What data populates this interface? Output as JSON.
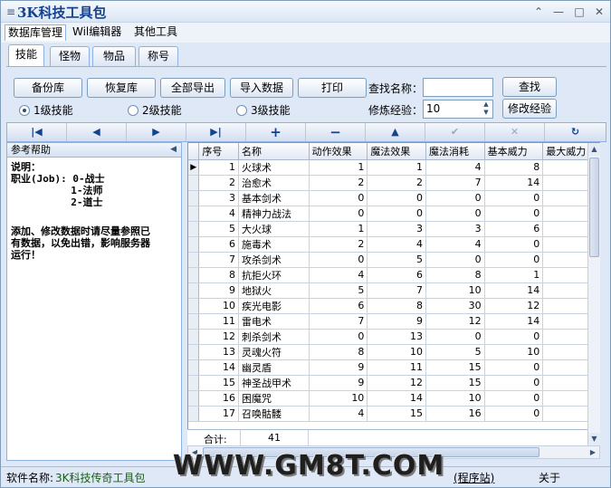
{
  "window": {
    "title": "3K科技工具包"
  },
  "menubar": {
    "items": [
      "数据库管理",
      "Wil编辑器",
      "其他工具"
    ]
  },
  "tabs": [
    "技能",
    "怪物",
    "物品",
    "称号"
  ],
  "toolbar": {
    "backup": "备份库",
    "restore": "恢复库",
    "export_all": "全部导出",
    "import": "导入数据",
    "print": "打印",
    "search_label": "查找名称：",
    "search_value": "",
    "search_button": "查找",
    "exp_label": "修炼经验：",
    "exp_value": "10",
    "modify_exp_button": "修改经验",
    "radios": [
      "1级技能",
      "2级技能",
      "3级技能"
    ],
    "selected_radio": 0
  },
  "navigator": [
    "first-icon",
    "prev-icon",
    "next-icon",
    "last-icon",
    "add-icon",
    "delete-icon",
    "up-icon",
    "confirm-icon",
    "cancel-icon",
    "refresh-icon"
  ],
  "help": {
    "title": "参考帮助",
    "lines": [
      "说明：",
      "职业(Job): 0-战士",
      "          1-法师",
      "          2-道士",
      "",
      "添加、修改数据时请尽量参照已",
      "有数据，以免出错，影响服务器",
      "运行！"
    ]
  },
  "grid": {
    "columns": [
      "序号",
      "名称",
      "动作效果",
      "魔法效果",
      "魔法消耗",
      "基本威力",
      "最大威力"
    ],
    "rows": [
      [
        "1",
        "火球术",
        "1",
        "1",
        "4",
        "8",
        ""
      ],
      [
        "2",
        "治愈术",
        "2",
        "2",
        "7",
        "14",
        ""
      ],
      [
        "3",
        "基本剑术",
        "0",
        "0",
        "0",
        "0",
        ""
      ],
      [
        "4",
        "精神力战法",
        "0",
        "0",
        "0",
        "0",
        ""
      ],
      [
        "5",
        "大火球",
        "1",
        "3",
        "3",
        "6",
        ""
      ],
      [
        "6",
        "施毒术",
        "2",
        "4",
        "4",
        "0",
        ""
      ],
      [
        "7",
        "攻杀剑术",
        "0",
        "5",
        "0",
        "0",
        ""
      ],
      [
        "8",
        "抗拒火环",
        "4",
        "6",
        "8",
        "1",
        ""
      ],
      [
        "9",
        "地狱火",
        "5",
        "7",
        "10",
        "14",
        ""
      ],
      [
        "10",
        "疾光电影",
        "6",
        "8",
        "30",
        "12",
        ""
      ],
      [
        "11",
        "雷电术",
        "7",
        "9",
        "12",
        "14",
        ""
      ],
      [
        "12",
        "刺杀剑术",
        "0",
        "13",
        "0",
        "0",
        ""
      ],
      [
        "13",
        "灵魂火符",
        "8",
        "10",
        "5",
        "10",
        ""
      ],
      [
        "14",
        "幽灵盾",
        "9",
        "11",
        "15",
        "0",
        ""
      ],
      [
        "15",
        "神圣战甲术",
        "9",
        "12",
        "15",
        "0",
        ""
      ],
      [
        "16",
        "困魔咒",
        "10",
        "14",
        "10",
        "0",
        ""
      ],
      [
        "17",
        "召唤骷髅",
        "4",
        "15",
        "16",
        "0",
        ""
      ]
    ],
    "current_row": 0,
    "footer_label": "合计:",
    "footer_value": "41"
  },
  "statusbar": {
    "software_label": "软件名称:",
    "software_name": "3K科技传奇工具包",
    "site_text": "(程序站)",
    "about": "关于"
  },
  "watermark": "WWW.GM8T.COM"
}
